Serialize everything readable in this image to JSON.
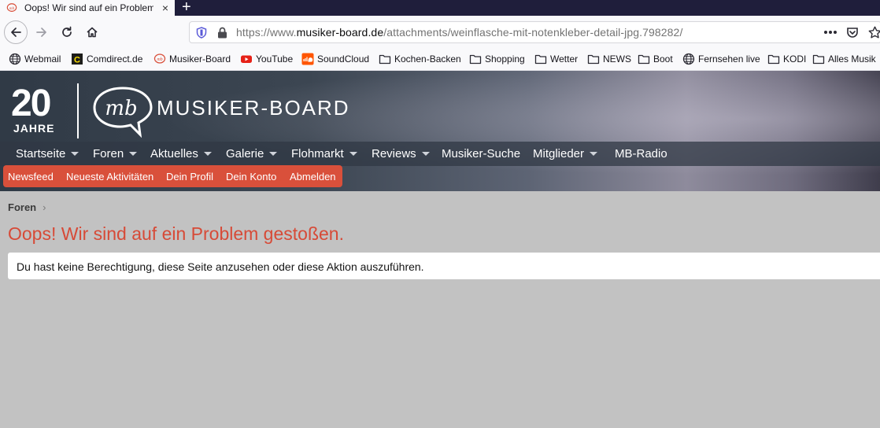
{
  "browser": {
    "tab": {
      "title": "Oops! Wir sind auf ein Problem gestoßen.",
      "close_icon": "×",
      "new_tab_icon": "+"
    },
    "url": {
      "prefix": "https://www.",
      "domain": "musiker-board.de",
      "path": "/attachments/weinflasche-mit-notenkleber-detail-jpg.798282/"
    },
    "bookmarks": [
      {
        "label": "Webmail",
        "icon": "globe-icon"
      },
      {
        "label": "Comdirect.de",
        "icon": "comdirect-icon"
      },
      {
        "label": "Musiker-Board",
        "icon": "musiker-board-icon"
      },
      {
        "label": "YouTube",
        "icon": "youtube-icon"
      },
      {
        "label": "SoundCloud",
        "icon": "soundcloud-icon"
      },
      {
        "label": "Kochen-Backen",
        "icon": "folder-icon"
      },
      {
        "label": "Shopping",
        "icon": "folder-icon"
      },
      {
        "label": "Wetter",
        "icon": "folder-icon"
      },
      {
        "label": "NEWS",
        "icon": "folder-icon"
      },
      {
        "label": "Boot",
        "icon": "folder-icon"
      },
      {
        "label": "Fernsehen live",
        "icon": "globe-icon"
      },
      {
        "label": "KODI",
        "icon": "folder-icon"
      },
      {
        "label": "Alles Musik",
        "icon": "folder-icon"
      }
    ]
  },
  "site": {
    "logo": {
      "anniversary_number": "20",
      "anniversary_word": "JAHRE",
      "name": "MUSIKER-BOARD"
    },
    "nav": [
      {
        "label": "Startseite",
        "has_menu": true
      },
      {
        "label": "Foren",
        "has_menu": true
      },
      {
        "label": "Aktuelles",
        "has_menu": true
      },
      {
        "label": "Galerie",
        "has_menu": true
      },
      {
        "label": "Flohmarkt",
        "has_menu": true
      },
      {
        "label": "Reviews",
        "has_menu": true
      },
      {
        "label": "Musiker-Suche",
        "has_menu": false
      },
      {
        "label": "Mitglieder",
        "has_menu": true
      },
      {
        "label": "MB-Radio",
        "has_menu": false
      }
    ],
    "subnav": [
      "Newsfeed",
      "Neueste Aktivitäten",
      "Dein Profil",
      "Dein Konto",
      "Abmelden"
    ]
  },
  "content": {
    "breadcrumb": "Foren",
    "title": "Oops! Wir sind auf ein Problem gestoßen.",
    "message": "Du hast keine Berechtigung, diese Seite anzusehen oder diese Aktion auszuführen."
  },
  "colors": {
    "accent": "#d9503b",
    "title": "#d74a37",
    "background": "#c2c2c2"
  }
}
